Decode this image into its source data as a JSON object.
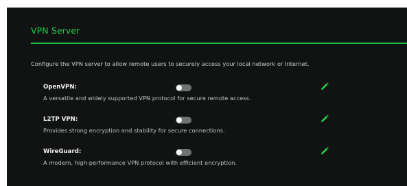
{
  "section": {
    "title": "VPN Server",
    "description": "Configure the VPN server to allow remote users to securely access your local network or Internet."
  },
  "colors": {
    "accent": "#22c94a",
    "background": "#111312",
    "toggle_off": "#6f7472"
  },
  "vpn_servers": [
    {
      "name": "OpenVPN:",
      "description": "A versatile and widely supported VPN protocol for secure remote access.",
      "enabled": false,
      "edit_icon": "pencil-icon"
    },
    {
      "name": "L2TP VPN:",
      "description": "Provides strong encryption and stability for secure connections.",
      "enabled": false,
      "edit_icon": "pencil-icon"
    },
    {
      "name": "WireGuard:",
      "description": "A modern, high-performance VPN protocol with efficient encryption.",
      "enabled": false,
      "edit_icon": "pencil-icon"
    }
  ]
}
